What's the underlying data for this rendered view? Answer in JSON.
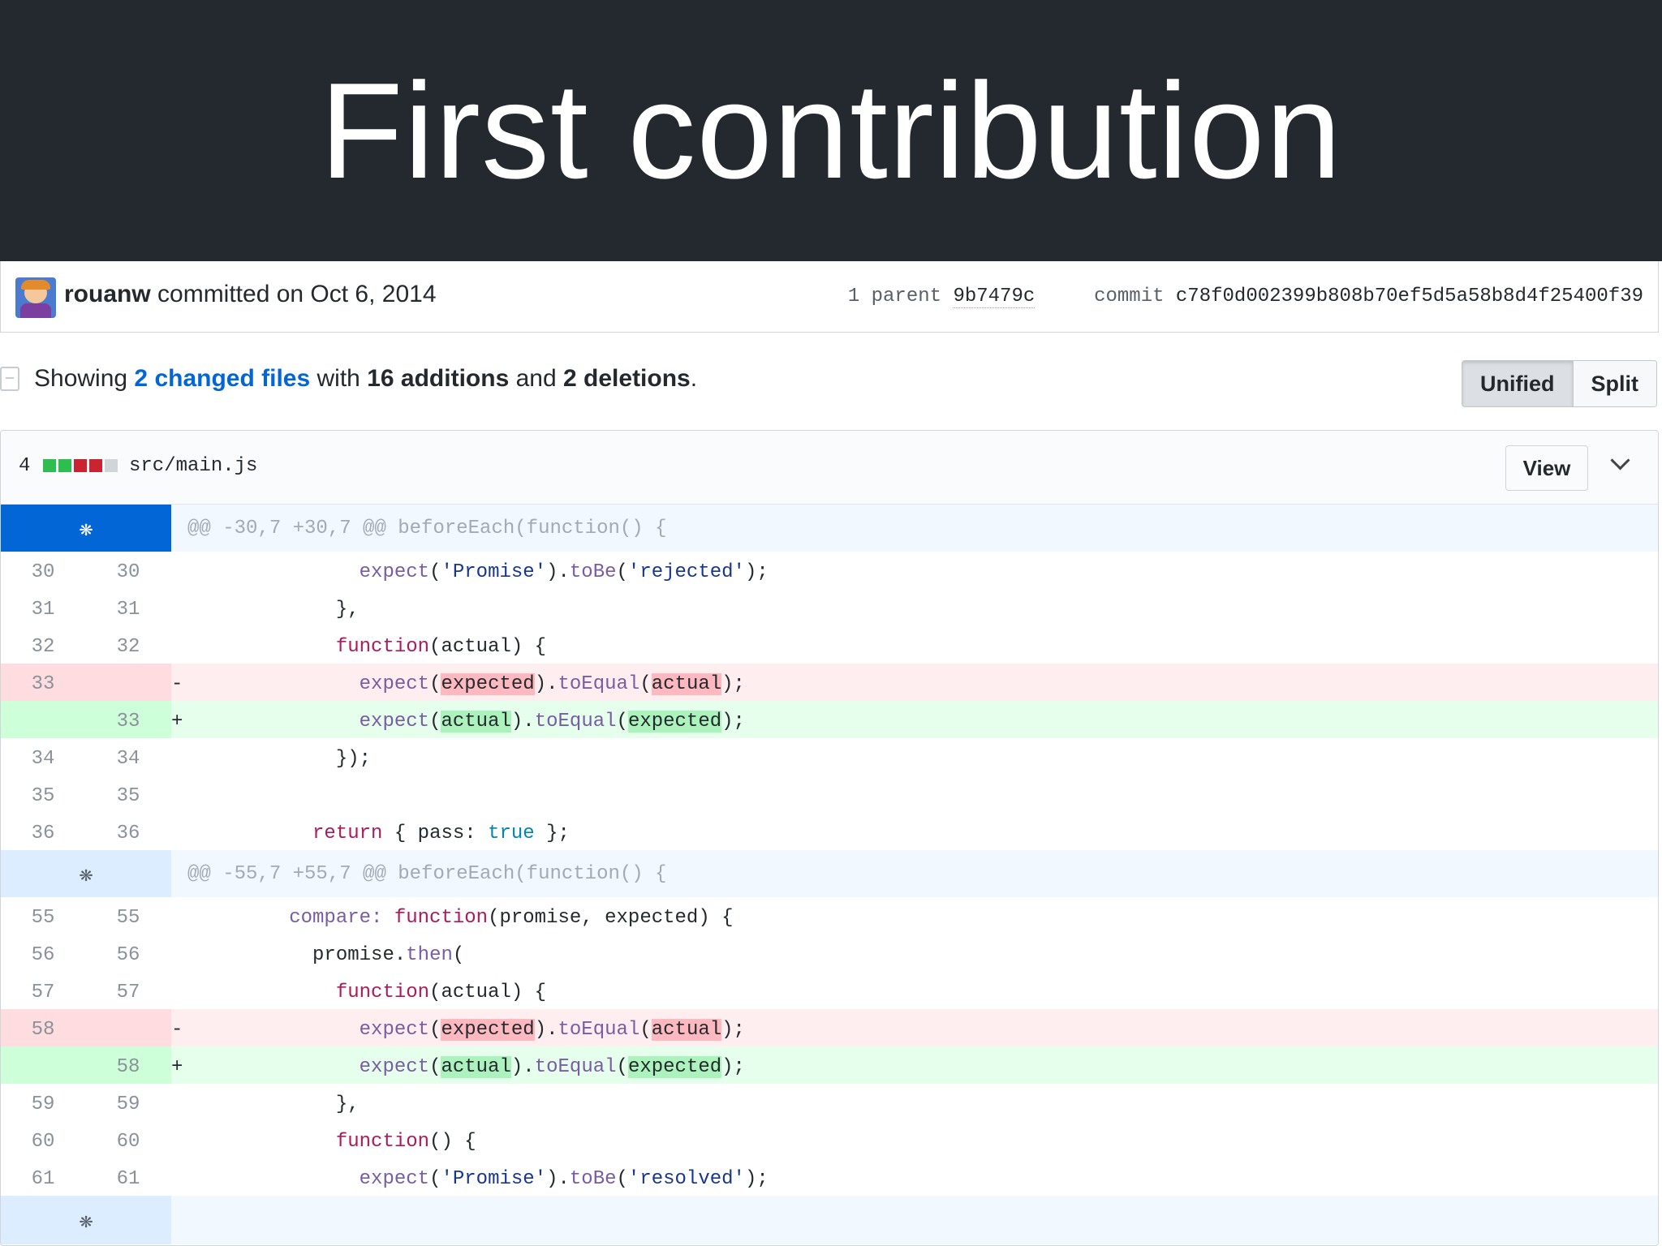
{
  "slide": {
    "title": "First contribution"
  },
  "commit": {
    "author": "rouanw",
    "action": "committed on Oct 6, 2014",
    "parent_label": "1 parent",
    "parent_sha": "9b7479c",
    "commit_label": "commit",
    "commit_sha": "c78f0d002399b808b70ef5d5a58b8d4f25400f39"
  },
  "summary": {
    "showing": "Showing",
    "changed_files": "2 changed files",
    "with": "with",
    "additions": "16 additions",
    "and": "and",
    "deletions": "2 deletions",
    "period": ".",
    "toggle_unified": "Unified",
    "toggle_split": "Split"
  },
  "file": {
    "change_count": "4",
    "name": "src/main.js",
    "view_label": "View",
    "diffstat_colors": [
      "#2cbe4e",
      "#2cbe4e",
      "#cb2431",
      "#cb2431",
      "#d1d5da"
    ]
  },
  "hunks": [
    {
      "header": "@@ -30,7 +30,7 @@ beforeEach(function() {"
    },
    {
      "header": "@@ -55,7 +55,7 @@ beforeEach(function() {"
    }
  ],
  "line_numbers": {
    "h1": [
      {
        "l": "30",
        "r": "30"
      },
      {
        "l": "31",
        "r": "31"
      },
      {
        "l": "32",
        "r": "32"
      },
      {
        "l": "33",
        "r": ""
      },
      {
        "l": "",
        "r": "33"
      },
      {
        "l": "34",
        "r": "34"
      },
      {
        "l": "35",
        "r": "35"
      },
      {
        "l": "36",
        "r": "36"
      }
    ],
    "h2": [
      {
        "l": "55",
        "r": "55"
      },
      {
        "l": "56",
        "r": "56"
      },
      {
        "l": "57",
        "r": "57"
      },
      {
        "l": "58",
        "r": ""
      },
      {
        "l": "",
        "r": "58"
      },
      {
        "l": "59",
        "r": "59"
      },
      {
        "l": "60",
        "r": "60"
      },
      {
        "l": "61",
        "r": "61"
      }
    ]
  },
  "code_text": {
    "expect": "expect",
    "promise_str": "'Promise'",
    "tobe": "toBe",
    "rejected_str": "'rejected'",
    "resolved_str": "'resolved'",
    "function": "function",
    "actual": "actual",
    "expected": "expected",
    "toequal": "toEqual",
    "return": "return",
    "pass": "pass:",
    "true": "true",
    "compare": "compare:",
    "promise": "promise",
    "then": "then",
    "minus": "-",
    "plus": "+"
  },
  "icons": {
    "expand": "unfold-icon",
    "file": "file-diff-icon",
    "chevron": "chevron-down-icon"
  }
}
